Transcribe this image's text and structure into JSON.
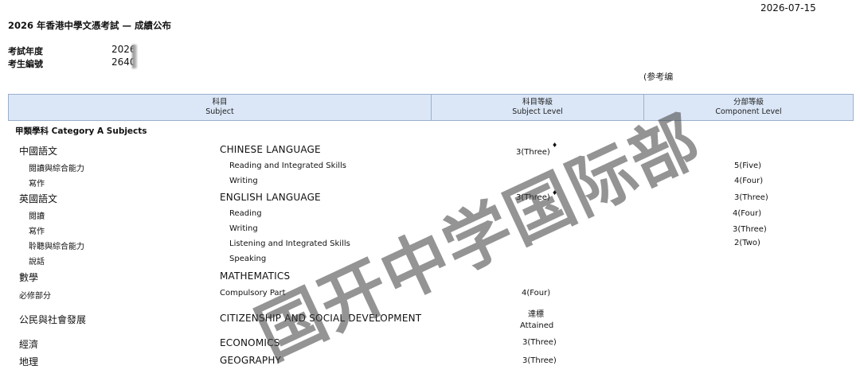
{
  "date": "2026-07-15",
  "title": "2026 年香港中學文憑考試 — 成績公布",
  "exam_year_label": "考試年度",
  "exam_year_value": "2026",
  "candidate_no_label": "考生編號",
  "candidate_no_value": "2640",
  "reference_label": "(参考编",
  "header": {
    "subject_zh": "科目",
    "subject_en": "Subject",
    "level_zh": "科目等級",
    "level_en": "Subject Level",
    "component_zh": "分部等級",
    "component_en": "Component Level"
  },
  "category": "甲類學科 Category A Subjects",
  "subjects": [
    {
      "zh": "中國語文",
      "en": "CHINESE LANGUAGE",
      "level": "3(Three)",
      "mark": "♦"
    },
    {
      "zh": "閱讀與綜合能力",
      "en": "Reading and Integrated Skills",
      "component": "5(Five)"
    },
    {
      "zh": "寫作",
      "en": "Writing",
      "component": "4(Four)"
    },
    {
      "zh": "英國語文",
      "en": "ENGLISH LANGUAGE",
      "level": "3(Three)",
      "mark": "♦",
      "component": "3(Three)"
    },
    {
      "zh": "閱讀",
      "en": "Reading",
      "component": "4(Four)"
    },
    {
      "zh": "寫作",
      "en": "Writing",
      "component": "3(Three)"
    },
    {
      "zh": "聆聽與綜合能力",
      "en": "Listening and Integrated Skills",
      "component": "2(Two)"
    },
    {
      "zh": "說話",
      "en": "Speaking"
    },
    {
      "zh": "數學",
      "en": "MATHEMATICS"
    },
    {
      "zh": "必修部分",
      "en": "Compulsory Part",
      "level": "4(Four)"
    },
    {
      "zh": "公民與社會發展",
      "en": "CITIZENSHIP AND SOCIAL DEVELOPMENT",
      "level_zh": "達標",
      "level": "Attained"
    },
    {
      "zh": "經濟",
      "en": "ECONOMICS",
      "level": "3(Three)"
    },
    {
      "zh": "地理",
      "en": "GEOGRAPHY",
      "level": "3(Three)"
    }
  ],
  "watermark": "国开中学国际部"
}
